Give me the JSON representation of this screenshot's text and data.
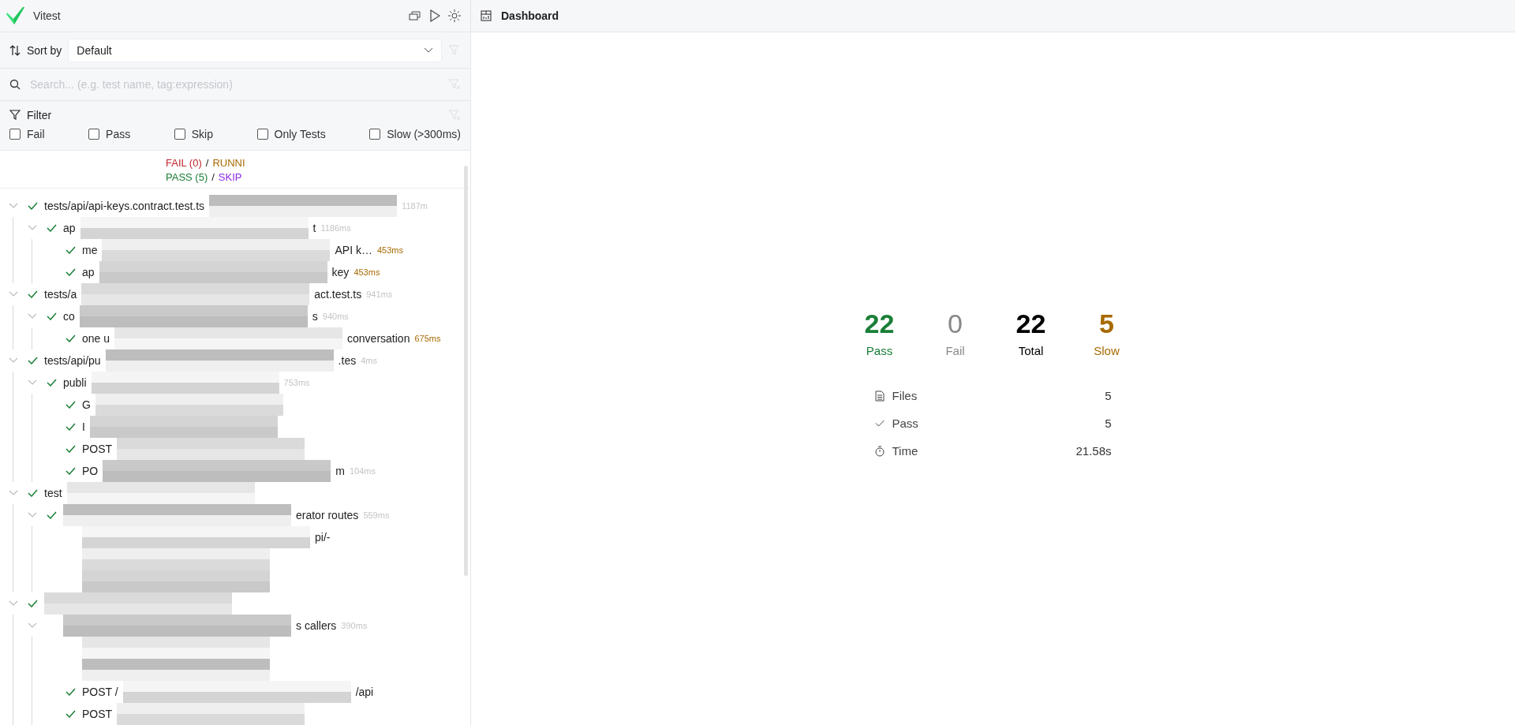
{
  "app": {
    "title": "Vitest"
  },
  "sort": {
    "label": "Sort by",
    "value": "Default"
  },
  "search": {
    "placeholder": "Search... (e.g. test name, tag:expression)"
  },
  "filter": {
    "label": "Filter",
    "options": [
      {
        "label": "Fail",
        "checked": false
      },
      {
        "label": "Pass",
        "checked": false
      },
      {
        "label": "Skip",
        "checked": false
      },
      {
        "label": "Only Tests",
        "checked": false
      },
      {
        "label": "Slow (>300ms)",
        "checked": false
      }
    ]
  },
  "summary": [
    [
      {
        "text": "FAIL (0)",
        "kind": "fail"
      },
      {
        "text": "/",
        "kind": "sep"
      },
      {
        "text": "RUNNI",
        "kind": "running"
      }
    ],
    [
      {
        "text": "PASS (5)",
        "kind": "pass"
      },
      {
        "text": "/",
        "kind": "sep"
      },
      {
        "text": "SKIP",
        "kind": "skip"
      }
    ]
  ],
  "tree": [
    {
      "passed": true,
      "expanded": true,
      "name_start": "tests/api/api-keys.contract.test.ts",
      "duration": "1187m",
      "slow": false,
      "children": [
        {
          "passed": true,
          "expanded": true,
          "name_start": "ap",
          "name_end": "t",
          "duration": "1186ms",
          "slow": false,
          "children": [
            {
              "passed": true,
              "name_start": "me",
              "name_end": "API k…",
              "duration": "453ms",
              "slow": true
            },
            {
              "passed": true,
              "name_start": "ap",
              "name_end": "key",
              "duration": "453ms",
              "slow": true
            }
          ]
        }
      ]
    },
    {
      "passed": true,
      "expanded": true,
      "name_start": "tests/a",
      "name_end": "act.test.ts",
      "duration": "941ms",
      "slow": false,
      "children": [
        {
          "passed": true,
          "expanded": true,
          "name_start": "co",
          "name_end": "s",
          "duration": "940ms",
          "slow": false,
          "children": [
            {
              "passed": true,
              "name_start": "one u",
              "name_end": "conversation",
              "duration": "675ms",
              "slow": true
            }
          ]
        }
      ]
    },
    {
      "passed": true,
      "expanded": true,
      "name_start": "tests/api/pu",
      "name_end": ".tes",
      "duration": "4ms",
      "slow": false,
      "children": [
        {
          "passed": true,
          "expanded": true,
          "name_start": "publi",
          "duration": "753ms",
          "slow": false,
          "children": [
            {
              "passed": true,
              "name_start": "G"
            },
            {
              "passed": true,
              "name_start": "I"
            },
            {
              "passed": true,
              "name_start": "POST"
            },
            {
              "passed": true,
              "name_start": "PO",
              "name_end": "m",
              "duration": "104ms",
              "slow": false
            }
          ]
        }
      ]
    },
    {
      "passed": true,
      "expanded": true,
      "name_start": "test",
      "children": [
        {
          "passed": true,
          "expanded": true,
          "name_end": "erator routes",
          "duration": "559ms",
          "slow": false,
          "children": [
            {
              "passed": false,
              "name_end": "pi/-"
            },
            {
              "passed": false
            },
            {
              "passed": false
            }
          ]
        }
      ]
    },
    {
      "passed": true,
      "expanded": true,
      "children": [
        {
          "passed": false,
          "expanded": true,
          "name_end": "s callers",
          "duration": "390ms",
          "slow": false,
          "children": [
            {
              "passed": false
            },
            {
              "passed": false
            },
            {
              "passed": true,
              "name_start": "POST /",
              "name_end": "/api"
            },
            {
              "passed": true,
              "name_start": "POST"
            }
          ]
        }
      ]
    }
  ],
  "dashboard": {
    "title": "Dashboard",
    "stats": [
      {
        "value": "22",
        "label": "Pass",
        "kind": "pass"
      },
      {
        "value": "0",
        "label": "Fail",
        "kind": "fail"
      },
      {
        "value": "22",
        "label": "Total",
        "kind": "total"
      },
      {
        "value": "5",
        "label": "Slow",
        "kind": "slow"
      }
    ],
    "details": [
      {
        "kind": "files",
        "label": "Files",
        "value": "5"
      },
      {
        "kind": "pass",
        "label": "Pass",
        "value": "5"
      },
      {
        "kind": "time",
        "label": "Time",
        "value": "21.58s"
      }
    ]
  }
}
